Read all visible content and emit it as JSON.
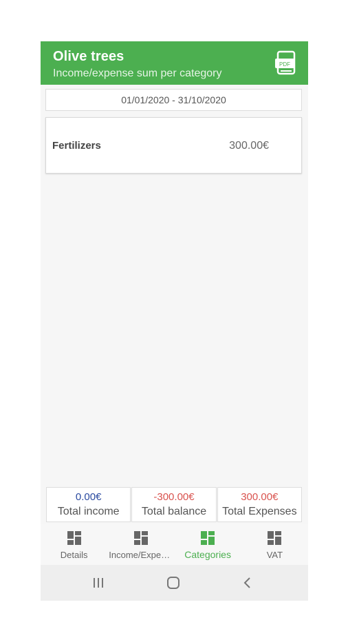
{
  "header": {
    "title": "Olive trees",
    "subtitle": "Income/expense sum per category",
    "pdf_icon_label": "PDF"
  },
  "date_range": "01/01/2020 - 31/10/2020",
  "categories": [
    {
      "name": "Fertilizers",
      "amount": "300.00€"
    }
  ],
  "totals": {
    "income": {
      "value": "0.00€",
      "label": "Total income",
      "color": "#2a4aa0"
    },
    "balance": {
      "value": "-300.00€",
      "label": "Total balance",
      "color": "#d9534f"
    },
    "expenses": {
      "value": "300.00€",
      "label": "Total Expenses",
      "color": "#d9534f"
    }
  },
  "nav": {
    "items": [
      {
        "label": "Details",
        "icon": "dashboard-icon",
        "active": false
      },
      {
        "label": "Income/Expen...",
        "icon": "dashboard-icon",
        "active": false
      },
      {
        "label": "Categories",
        "icon": "dashboard-icon",
        "active": true
      },
      {
        "label": "VAT",
        "icon": "dashboard-icon",
        "active": false
      }
    ]
  },
  "system_nav": {
    "buttons": [
      "recent-apps-icon",
      "home-icon",
      "back-icon"
    ]
  },
  "colors": {
    "accent": "#4caf50",
    "negative": "#d9534f",
    "positive_income": "#2a4aa0"
  }
}
